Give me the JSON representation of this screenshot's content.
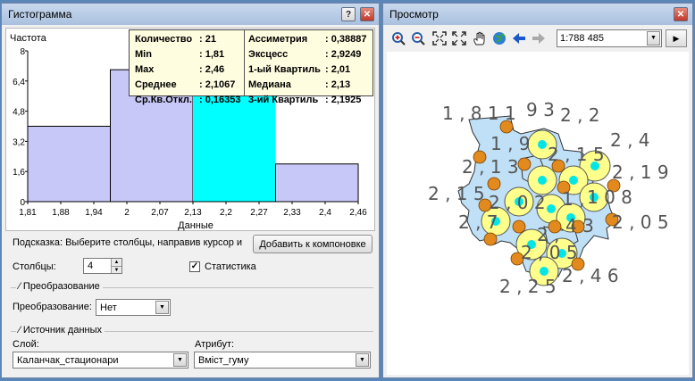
{
  "histogram_window": {
    "title": "Гистограмма",
    "help_label": "?",
    "close_label": "✕",
    "y_label": "Частота",
    "x_label": "Данные",
    "y_ticks": [
      "8",
      "6,4",
      "4,8",
      "3,2",
      "1,6",
      "0"
    ],
    "x_ticks": [
      "1,81",
      "1,88",
      "1,94",
      "2",
      "2,07",
      "2,13",
      "2,2",
      "2,27",
      "2,33",
      "2,4",
      "2,46"
    ],
    "stats_left": [
      {
        "label": "Количество",
        "value": ": 21"
      },
      {
        "label": "Min",
        "value": ": 1,81"
      },
      {
        "label": "Max",
        "value": ": 2,46"
      },
      {
        "label": "Среднее",
        "value": ": 2,1067"
      },
      {
        "label": "Ср.Кв.Откл.",
        "value": ": 0,16353"
      }
    ],
    "stats_right": [
      {
        "label": "Ассиметрия",
        "value": ": 0,38887"
      },
      {
        "label": "Эксцесс",
        "value": ": 2,9249"
      },
      {
        "label": "1-ый Квартиль",
        "value": ": 2,01"
      },
      {
        "label": "Медиана",
        "value": ": 2,13"
      },
      {
        "label": "3-ий Квартиль",
        "value": ": 2,1925"
      }
    ],
    "hint": "Подсказка:  Выберите столбцы, направив курсор и",
    "add_button": "Добавить к компоновке",
    "bins_label": "Столбцы:",
    "bins_value": "4",
    "stats_checked": "✓",
    "stats_label": "Статистика",
    "transform_group": "Преобразование",
    "transform_label": "Преобразование:",
    "transform_value": "Нет",
    "source_group": "Источник данных",
    "layer_label": "Слой:",
    "layer_value": "Каланчак_стационари",
    "attribute_label": "Атрибут:",
    "attribute_value": "Вміст_гуму",
    "dropdown_arrow": "▼"
  },
  "chart_data": {
    "type": "bar",
    "categories": [
      "1,81–1,97",
      "1,97–2,13",
      "2,13–2,30",
      "2,30–2,46"
    ],
    "values": [
      4,
      7,
      8,
      2
    ],
    "bin_edges": [
      1.81,
      1.9725,
      2.135,
      2.2975,
      2.46
    ],
    "highlighted_bin": 2,
    "xlim": [
      1.81,
      2.46
    ],
    "ylim": [
      0,
      8
    ],
    "ylabel": "Частота",
    "xlabel": "Данные",
    "colors": {
      "bar": "#c8c8f8",
      "highlight": "#00ffff",
      "stroke": "#000000"
    }
  },
  "viewer_window": {
    "title": "Просмотр",
    "close_label": "✕",
    "scale_value": "1:788 485",
    "dropdown_arrow": "▼",
    "play_label": "▶",
    "tools": [
      "zoom-in-icon",
      "zoom-out-icon",
      "full-extent-icon",
      "fixed-zoom-icon",
      "pan-icon",
      "globe-icon",
      "back-icon",
      "forward-icon"
    ],
    "map_labels": [
      "1 , 8 1 1",
      "9 3",
      "2 , 2",
      "1 , 9",
      "2 , 4",
      "2 , 1 3",
      "2 , 1 5",
      "2 , 1 9",
      "2 , 1 5",
      "1 0 8",
      "2 , 7",
      "2 , 0 2",
      "1 ,",
      "2 , 0 5",
      "4 3",
      "2 , 0 5",
      "2 , 4 6",
      "2 , 2 5",
      "2 ,"
    ],
    "colors": {
      "polygon": "#bfe0f6",
      "big_circle": "#ffff8c",
      "center": "#00e6e6",
      "orange": "#e38a1e"
    }
  }
}
